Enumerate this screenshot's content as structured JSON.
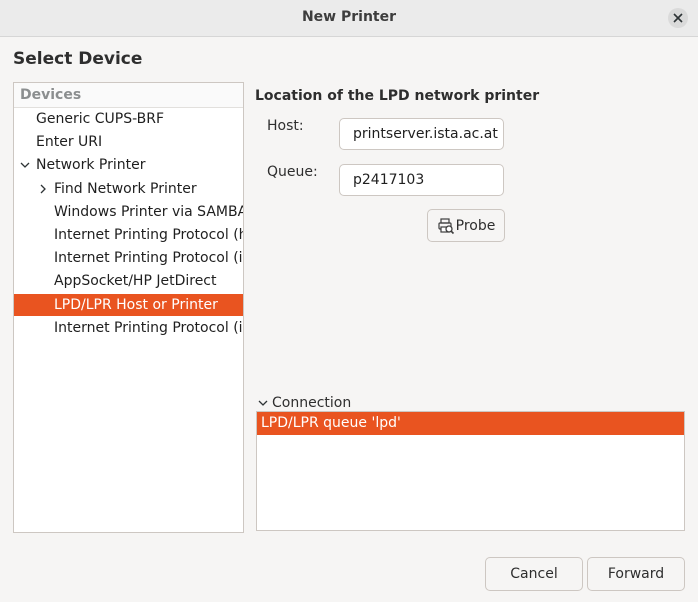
{
  "window": {
    "title": "New Printer"
  },
  "heading": "Select Device",
  "device_tree": {
    "header": "Devices",
    "items": [
      {
        "label": "Generic CUPS-BRF",
        "level": 0,
        "expander": "none",
        "selected": false
      },
      {
        "label": "Enter URI",
        "level": 0,
        "expander": "none",
        "selected": false
      },
      {
        "label": "Network Printer",
        "level": 0,
        "expander": "expanded",
        "selected": false
      },
      {
        "label": "Find Network Printer",
        "level": 1,
        "expander": "collapsed",
        "selected": false
      },
      {
        "label": "Windows Printer via SAMBA",
        "level": 1,
        "expander": "none",
        "selected": false
      },
      {
        "label": "Internet Printing Protocol (h",
        "level": 1,
        "expander": "none",
        "selected": false
      },
      {
        "label": "Internet Printing Protocol (ip",
        "level": 1,
        "expander": "none",
        "selected": false
      },
      {
        "label": "AppSocket/HP JetDirect",
        "level": 1,
        "expander": "none",
        "selected": false
      },
      {
        "label": "LPD/LPR Host or Printer",
        "level": 1,
        "expander": "none",
        "selected": true
      },
      {
        "label": "Internet Printing Protocol (ip",
        "level": 1,
        "expander": "none",
        "selected": false
      }
    ]
  },
  "details": {
    "section_title": "Location of the LPD network printer",
    "host": {
      "label": "Host:",
      "value": "printserver.ista.ac.at"
    },
    "queue": {
      "label": "Queue:",
      "value": "p2417103"
    },
    "probe_label": "Probe"
  },
  "connection": {
    "label": "Connection",
    "items": [
      "LPD/LPR queue 'lpd'"
    ]
  },
  "buttons": {
    "cancel": "Cancel",
    "forward": "Forward"
  },
  "colors": {
    "accent": "#e95420",
    "background": "#f6f5f4"
  }
}
